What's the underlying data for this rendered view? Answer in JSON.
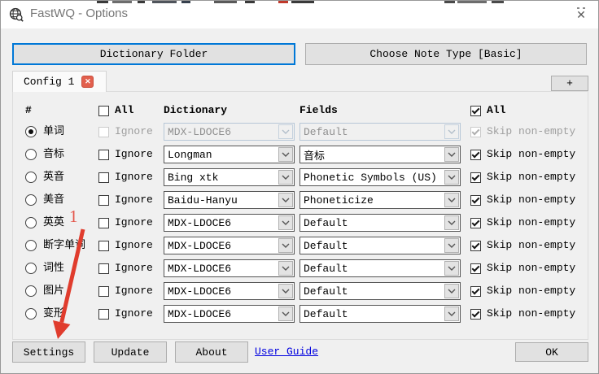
{
  "window": {
    "title": "FastWQ - Options",
    "close_glyph": "✕"
  },
  "toolbar": {
    "dictionary_folder_label": "Dictionary Folder",
    "choose_note_type_label": "Choose Note Type [Basic]"
  },
  "tabs": {
    "active_label": "Config 1",
    "close_glyph": "✕",
    "add_label": "+"
  },
  "table": {
    "headers": {
      "hash": "#",
      "all_left": "All",
      "dictionary": "Dictionary",
      "fields": "Fields",
      "all_right": "All"
    },
    "all_left_checked": false,
    "all_right_checked": true,
    "ignore_label": "Ignore",
    "skip_label": "Skip non-empty",
    "rows": [
      {
        "label": "单词",
        "selected": true,
        "disabled": true,
        "ignore_checked": false,
        "dictionary": "MDX-LDOCE6",
        "field": "Default",
        "skip_checked": true
      },
      {
        "label": "音标",
        "selected": false,
        "disabled": false,
        "ignore_checked": false,
        "dictionary": "Longman",
        "field": "音标",
        "skip_checked": true
      },
      {
        "label": "英音",
        "selected": false,
        "disabled": false,
        "ignore_checked": false,
        "dictionary": "Bing xtk",
        "field": "Phonetic Symbols (US)",
        "skip_checked": true
      },
      {
        "label": "美音",
        "selected": false,
        "disabled": false,
        "ignore_checked": false,
        "dictionary": "Baidu-Hanyu",
        "field": "Phoneticize",
        "skip_checked": true
      },
      {
        "label": "英英",
        "selected": false,
        "disabled": false,
        "ignore_checked": false,
        "dictionary": "MDX-LDOCE6",
        "field": "Default",
        "skip_checked": true
      },
      {
        "label": "断字单词",
        "selected": false,
        "disabled": false,
        "ignore_checked": false,
        "dictionary": "MDX-LDOCE6",
        "field": "Default",
        "skip_checked": true
      },
      {
        "label": "词性",
        "selected": false,
        "disabled": false,
        "ignore_checked": false,
        "dictionary": "MDX-LDOCE6",
        "field": "Default",
        "skip_checked": true
      },
      {
        "label": "图片",
        "selected": false,
        "disabled": false,
        "ignore_checked": false,
        "dictionary": "MDX-LDOCE6",
        "field": "Default",
        "skip_checked": true
      },
      {
        "label": "变形",
        "selected": false,
        "disabled": false,
        "ignore_checked": false,
        "dictionary": "MDX-LDOCE6",
        "field": "Default",
        "skip_checked": true
      }
    ]
  },
  "footer": {
    "settings_label": "Settings",
    "update_label": "Update",
    "about_label": "About",
    "user_guide_label": "User Guide",
    "ok_label": "OK"
  },
  "annotation": {
    "step_number": "1"
  },
  "colors": {
    "focus_border": "#0078d7",
    "annotation_red": "#e03c2d",
    "tab_close_red": "#e2604e",
    "link_blue": "#0000e0",
    "dialog_bg": "#f0f0f0",
    "titlebar_bg": "#ffffff"
  }
}
